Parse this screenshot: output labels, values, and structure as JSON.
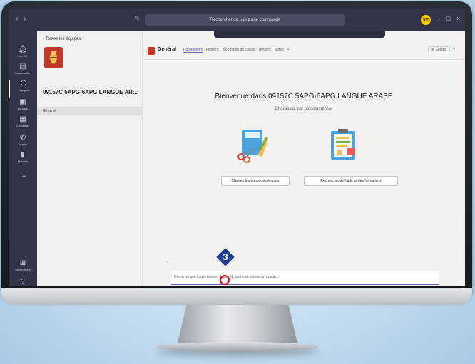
{
  "titlebar": {
    "nav_back": "‹",
    "nav_forward": "›",
    "search_placeholder": "Rechercher ou tapez une commande",
    "user_initials": "EM",
    "minimize": "–",
    "maximize": "□",
    "close": "×"
  },
  "appbar": {
    "items": [
      {
        "label": "Activité",
        "icon": "bell-icon"
      },
      {
        "label": "Conversation",
        "icon": "chat-icon"
      },
      {
        "label": "Équipes",
        "icon": "teams-icon"
      },
      {
        "label": "Devoirs",
        "icon": "assignments-icon"
      },
      {
        "label": "Calendrier",
        "icon": "calendar-icon"
      },
      {
        "label": "Appels",
        "icon": "phone-icon"
      },
      {
        "label": "Fichiers",
        "icon": "files-icon"
      },
      {
        "label": "...",
        "icon": "more-icon"
      },
      {
        "label": "Applications",
        "icon": "apps-icon"
      },
      {
        "label": "Aide",
        "icon": "help-icon"
      }
    ]
  },
  "teampanel": {
    "back_label": "Toutes les équipes",
    "team_name": "09157C 5APG-6APG LANGUE AR...",
    "more": "···",
    "channels": [
      "Général"
    ]
  },
  "channel": {
    "title": "Général",
    "tabs": [
      "Publications",
      "Fichiers",
      "Bloc-notes de classe",
      "Devoirs",
      "Notes",
      "+"
    ],
    "team_button": "⊕ Équipe",
    "more": "···"
  },
  "welcome": {
    "title": "Bienvenue dans 09157C 5APG-6APG LANGUE ARABE",
    "subtitle": "Choisissez par où commencer",
    "actions": [
      "Charger les supports de cours",
      "Rechercher de l'aide et des formations"
    ]
  },
  "compose": {
    "placeholder": "Démarrer une conversation. Tapez @ pour mentionner un contact.",
    "toolbar_icons": [
      "format-icon",
      "attach-icon",
      "emoji-icon",
      "giphy-icon",
      "sticker-icon",
      "meet-icon",
      "send-later-icon",
      "praise-icon",
      "more-icon"
    ],
    "toolbar_glyphs": [
      "A̷",
      "⊘",
      "☺",
      "▣",
      "▤",
      "▦",
      "▷",
      "♀",
      "···"
    ],
    "send": "➢",
    "caret": "⌄"
  },
  "annotation": {
    "step": "3"
  },
  "colors": {
    "accent": "#6264a7",
    "titlebar": "#33344a",
    "team_logo": "#c0392b",
    "step_marker": "#1f3f91",
    "highlight": "#d0021b"
  }
}
